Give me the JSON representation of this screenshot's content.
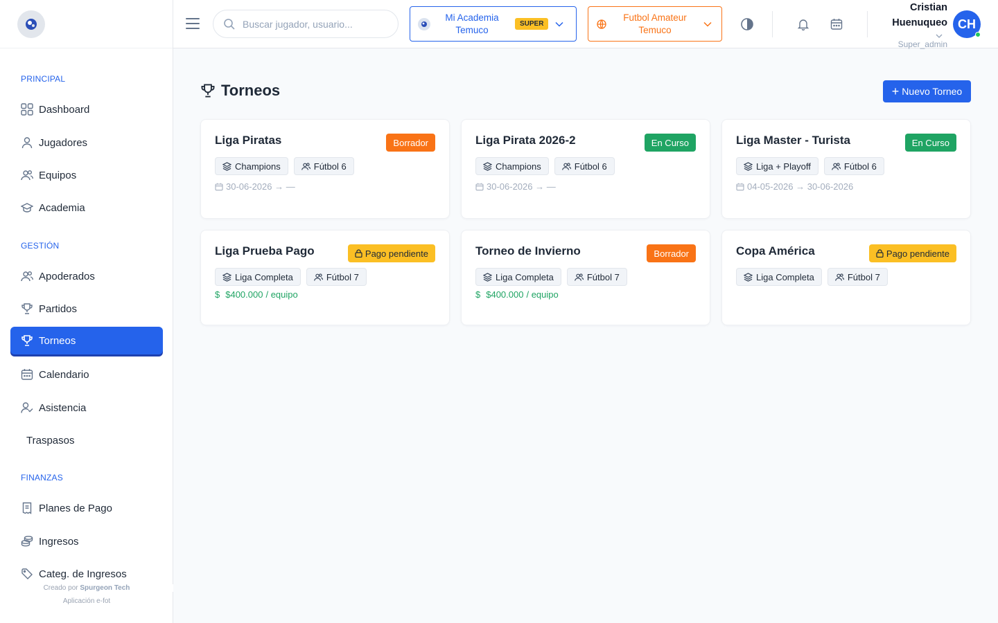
{
  "sidebar": {
    "sections": {
      "principal": "PRINCIPAL",
      "gestion": "GESTIÓN",
      "finanzas": "FINANZAS"
    },
    "items": {
      "dashboard": "Dashboard",
      "jugadores": "Jugadores",
      "equipos": "Equipos",
      "academia": "Academia",
      "apoderados": "Apoderados",
      "partidos": "Partidos",
      "torneos": "Torneos",
      "calendario": "Calendario",
      "asistencia": "Asistencia",
      "traspasos": "Traspasos",
      "planes": "Planes de Pago",
      "ingresos": "Ingresos",
      "categ": "Categ. de Ingresos"
    },
    "active": "torneos",
    "footer": {
      "created_prefix": "Creado por",
      "company": "Spurgeon Tech",
      "app": "Aplicación e-fot"
    }
  },
  "topbar": {
    "search_placeholder": "Buscar jugador, usuario...",
    "academy": {
      "line1": "Mi Academia",
      "line2": "Temuco",
      "badge": "SUPER"
    },
    "league": {
      "line1": "Futbol Amateur",
      "line2": "Temuco"
    },
    "user": {
      "first": "Cristian",
      "last": "Huenuqueo",
      "role": "Super_admin",
      "initials": "CH"
    }
  },
  "page": {
    "title": "Torneos",
    "new_button": "Nuevo Torneo"
  },
  "tournaments": [
    {
      "name": "Liga Piratas",
      "status": "Borrador",
      "format": "Champions",
      "modality": "Fútbol 6",
      "dates": "30-06-2026 → —"
    },
    {
      "name": "Liga Pirata 2026-2",
      "status": "En Curso",
      "format": "Champions",
      "modality": "Fútbol 6",
      "dates": "30-06-2026 → —"
    },
    {
      "name": "Liga Master - Turista",
      "status": "En Curso",
      "format": "Liga + Playoff",
      "modality": "Fútbol 6",
      "dates": "04-05-2026 → 30-06-2026"
    },
    {
      "name": "Liga Prueba Pago",
      "status": "Pago pendiente",
      "format": "Liga Completa",
      "modality": "Fútbol 7",
      "price": "$400.000",
      "price_suffix": "/ equipo"
    },
    {
      "name": "Torneo de Invierno",
      "status": "Borrador",
      "format": "Liga Completa",
      "modality": "Fútbol 7",
      "price": "$400.000",
      "price_suffix": "/ equipo"
    },
    {
      "name": "Copa América",
      "status": "Pago pendiente",
      "format": "Liga Completa",
      "modality": "Fútbol 7"
    }
  ],
  "colors": {
    "primary": "#2563eb",
    "orange": "#f97316",
    "green": "#1fa463",
    "amber": "#fbbf24"
  }
}
